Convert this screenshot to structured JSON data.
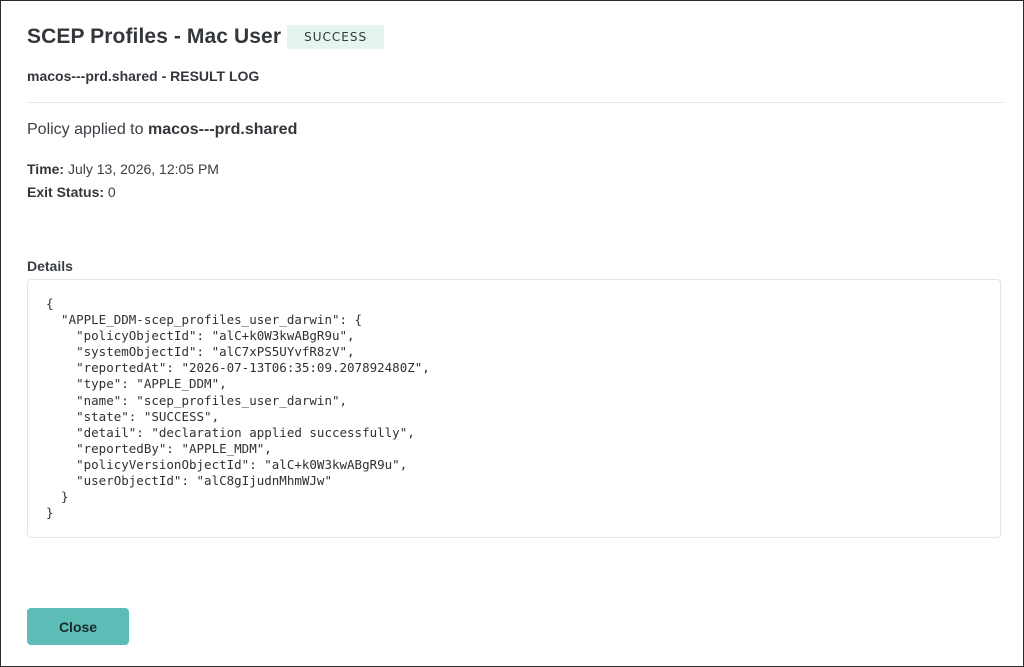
{
  "header": {
    "title": "SCEP Profiles - Mac User",
    "status_badge": "SUCCESS"
  },
  "subtitle": "macos---prd.shared - RESULT LOG",
  "policy": {
    "prefix": "Policy applied to ",
    "target": "macos---prd.shared"
  },
  "meta": {
    "time_label": "Time:",
    "time_value": " July 13, 2026, 12:05 PM",
    "exit_label": "Exit Status:",
    "exit_value": " 0"
  },
  "details": {
    "label": "Details",
    "json_text": "{\n  \"APPLE_DDM-scep_profiles_user_darwin\": {\n    \"policyObjectId\": \"alC+k0W3kwABgR9u\",\n    \"systemObjectId\": \"alC7xPS5UYvfR8zV\",\n    \"reportedAt\": \"2026-07-13T06:35:09.207892480Z\",\n    \"type\": \"APPLE_DDM\",\n    \"name\": \"scep_profiles_user_darwin\",\n    \"state\": \"SUCCESS\",\n    \"detail\": \"declaration applied successfully\",\n    \"reportedBy\": \"APPLE_MDM\",\n    \"policyVersionObjectId\": \"alC+k0W3kwABgR9u\",\n    \"userObjectId\": \"alC8gIjudnMhmWJw\"\n  }\n}"
  },
  "footer": {
    "close_label": "Close"
  },
  "colors": {
    "accent": "#5bbdb6",
    "badge_bg": "#e5f4ef"
  }
}
